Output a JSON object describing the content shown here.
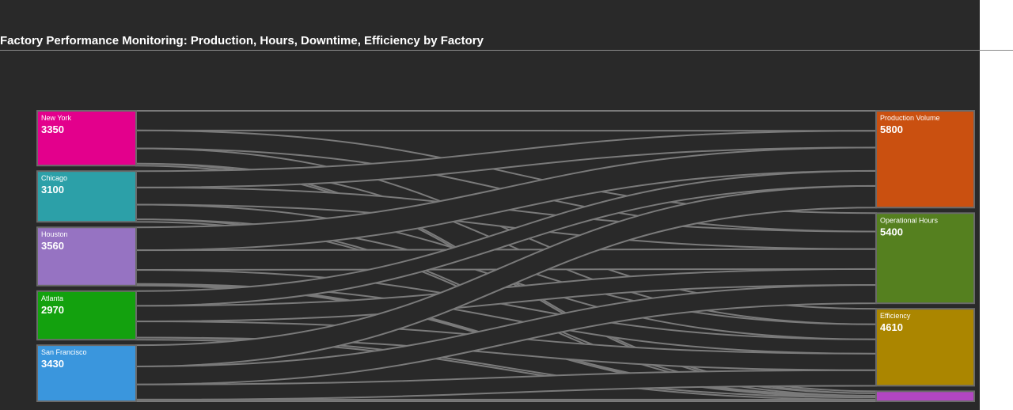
{
  "title": "Factory Performance Monitoring: Production, Hours, Downtime, Efficiency by Factory",
  "chart_data": {
    "type": "sankey",
    "title": "Factory Performance Monitoring: Production, Hours, Downtime, Efficiency by Factory",
    "sources": [
      {
        "name": "New York",
        "value": 3350,
        "color": "#e3008c"
      },
      {
        "name": "Chicago",
        "value": 3100,
        "color": "#2ca0a8"
      },
      {
        "name": "Houston",
        "value": 3560,
        "color": "#9673c2"
      },
      {
        "name": "Atlanta",
        "value": 2970,
        "color": "#13a10e"
      },
      {
        "name": "San Francisco",
        "value": 3430,
        "color": "#3a96dd"
      }
    ],
    "targets": [
      {
        "name": "Production Volume",
        "value": 5800,
        "color": "#ca5010"
      },
      {
        "name": "Operational Hours",
        "value": 5400,
        "color": "#55801f"
      },
      {
        "name": "Efficiency",
        "value": 4610,
        "color": "#ab8600"
      },
      {
        "name": "",
        "value": 600,
        "color": "#b146c2"
      }
    ],
    "links": [
      {
        "source": "New York",
        "target": "Production Volume",
        "value": 1200
      },
      {
        "source": "New York",
        "target": "Operational Hours",
        "value": 1100
      },
      {
        "source": "New York",
        "target": "Efficiency",
        "value": 930
      },
      {
        "source": "New York",
        "target": "",
        "value": 120
      },
      {
        "source": "Chicago",
        "target": "Production Volume",
        "value": 1000
      },
      {
        "source": "Chicago",
        "target": "Operational Hours",
        "value": 1050
      },
      {
        "source": "Chicago",
        "target": "Efficiency",
        "value": 900
      },
      {
        "source": "Chicago",
        "target": "",
        "value": 150
      },
      {
        "source": "Houston",
        "target": "Production Volume",
        "value": 1400
      },
      {
        "source": "Houston",
        "target": "Operational Hours",
        "value": 1200
      },
      {
        "source": "Houston",
        "target": "Efficiency",
        "value": 860
      },
      {
        "source": "Houston",
        "target": "",
        "value": 100
      },
      {
        "source": "Atlanta",
        "target": "Production Volume",
        "value": 900
      },
      {
        "source": "Atlanta",
        "target": "Operational Hours",
        "value": 950
      },
      {
        "source": "Atlanta",
        "target": "Efficiency",
        "value": 990
      },
      {
        "source": "Atlanta",
        "target": "",
        "value": 130
      },
      {
        "source": "San Francisco",
        "target": "Production Volume",
        "value": 1300
      },
      {
        "source": "San Francisco",
        "target": "Operational Hours",
        "value": 1100
      },
      {
        "source": "San Francisco",
        "target": "Efficiency",
        "value": 930
      },
      {
        "source": "San Francisco",
        "target": "",
        "value": 100
      }
    ]
  }
}
